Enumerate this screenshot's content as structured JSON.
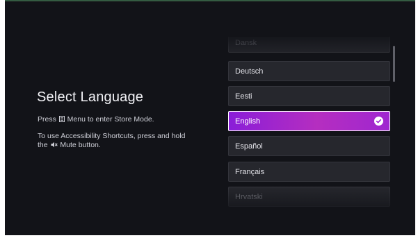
{
  "title": "Select Language",
  "hints": {
    "store_before": "Press ",
    "store_icon": "menu-icon",
    "store_after": " Menu to enter Store Mode.",
    "access_line1": "To use Accessibility Shortcuts, press and hold",
    "access_before": "the ",
    "access_icon": "mute-icon",
    "access_after": " Mute button."
  },
  "languages": [
    {
      "label": "Dansk",
      "selected": false
    },
    {
      "label": "Deutsch",
      "selected": false
    },
    {
      "label": "Eesti",
      "selected": false
    },
    {
      "label": "English",
      "selected": true
    },
    {
      "label": "Español",
      "selected": false
    },
    {
      "label": "Français",
      "selected": false
    },
    {
      "label": "Hrvatski",
      "selected": false
    }
  ],
  "selected_check_icon": "check-circle-icon",
  "colors": {
    "background": "#121318",
    "row": "#26272d",
    "selected_start": "#8a1dd8",
    "selected_end": "#b52ec0"
  }
}
